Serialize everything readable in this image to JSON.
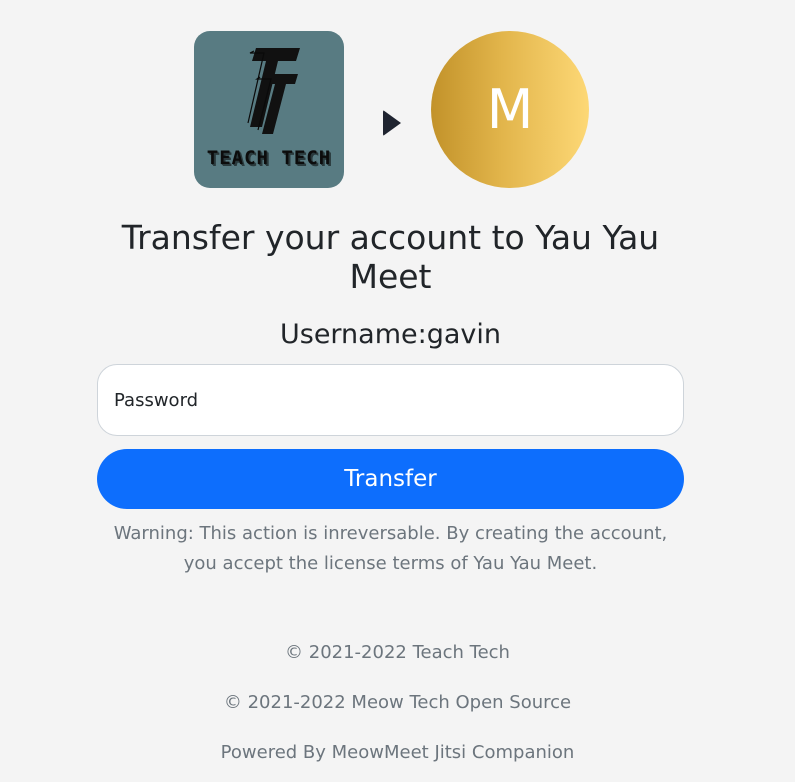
{
  "logos": {
    "source_logo": {
      "mark": "TT",
      "text": "TEACH TECH",
      "background": "#587b82"
    },
    "arrow_icon": "play-arrow-icon",
    "target_logo": {
      "letter": "M",
      "gradient": [
        "#c2922a",
        "#fdd876"
      ]
    }
  },
  "title": "Transfer your account to Yau Yau Meet",
  "username": "Username:gavin",
  "form": {
    "password_placeholder": "Password",
    "password_value": "",
    "submit_label": "Transfer",
    "accent_color": "#0d6efd"
  },
  "warning": "Warning: This action is inreversable. By creating the account, you accept the license terms of Yau Yau Meet.",
  "footer": {
    "copyright_1": "© 2021-2022 Teach Tech",
    "copyright_2": "© 2021-2022 Meow Tech Open Source",
    "powered_by": "Powered By MeowMeet Jitsi Companion"
  }
}
